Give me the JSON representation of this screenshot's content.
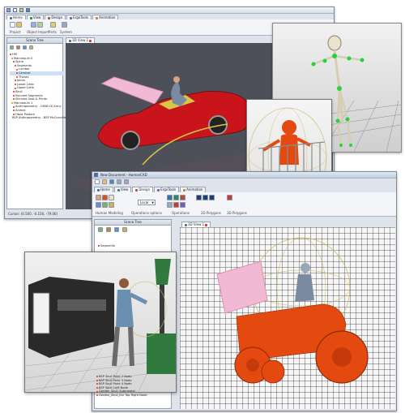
{
  "back_window": {
    "tabs": [
      "Home",
      "View",
      "Design",
      "ErgoTools",
      "Animation"
    ],
    "groups": [
      "Project",
      "Object Import",
      "Parts",
      "System"
    ],
    "scene_tree_title": "Scene Tree",
    "viewport_tab": "3D View 1",
    "tree_items": [
      "HM",
      "Mannequin 0",
      "Spine",
      "Segments",
      "Lumbar",
      "Cervical",
      "Thorax",
      "Joints",
      "Lower Limb",
      "Upper Limb",
      "Skull",
      "Skinned Segments",
      "Skinned Seat & Prints",
      "Mannequin 1",
      "Anthropometry - 1988 US Army",
      "Animal",
      "Hand Posture",
      "BSP Anthropometry - BSP McConville Male"
    ],
    "status_text": "Cursor: (0.500, -0.156, -79.06)"
  },
  "front_window": {
    "title": "New Document - HumanCAD",
    "tabs": [
      "Home",
      "View",
      "Design",
      "ErgoTools",
      "Animation"
    ],
    "local_select": "Local",
    "groups": [
      "Human Modeling",
      "Operations options",
      "Operations",
      "2D Polygons",
      "3D Polygons"
    ],
    "scene_tree_title": "Scene Tree",
    "viewport_tab": "3D View 1",
    "tree_items": [
      "Segments",
      "BSP Skull Point 2 Node",
      "BSP Skull Point 3 Node",
      "BSP Skull Point 4 Node",
      "BSP Skull CoM Node",
      "Gordon_Skull_Submeatal",
      "Gordon_Skull_Ear Top Right Node"
    ]
  },
  "colors": {
    "car_red": "#c8141a",
    "hood_pink": "#f2b9d4",
    "mannequin_orange": "#e44a10",
    "machine_green": "#2f7a3c",
    "ribbon_accent": "#3a6fb0"
  }
}
